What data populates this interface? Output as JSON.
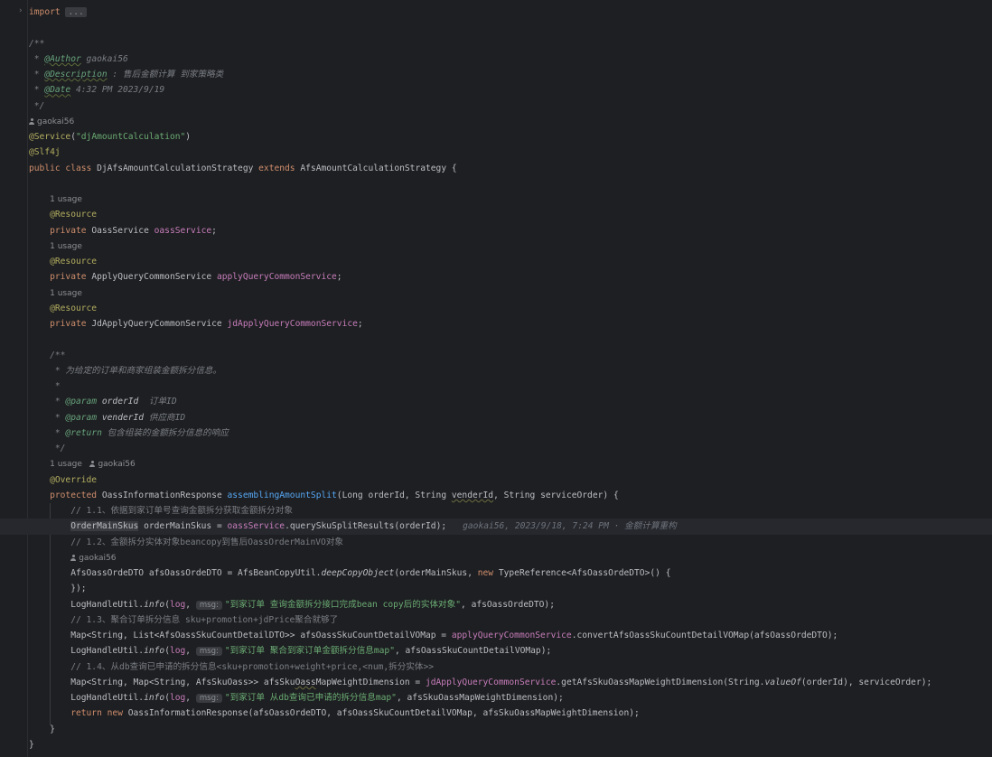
{
  "editor": {
    "colors": {
      "background": "#1e1f22",
      "keyword": "#cf8e6d",
      "annotation": "#b3ae60",
      "string": "#6aab73",
      "comment": "#7a7e85",
      "field": "#c77dbb",
      "method": "#56a8f5"
    },
    "highlighted_line": 33,
    "lines": [
      [
        [
          "kw",
          "import "
        ],
        [
          "fold-ph",
          "..."
        ]
      ],
      [],
      [
        [
          "doc",
          "/**"
        ]
      ],
      [
        [
          "doc",
          " * "
        ],
        [
          "tag",
          "@Author"
        ],
        [
          "doc",
          " "
        ],
        [
          "doc",
          "gaokai56"
        ]
      ],
      [
        [
          "doc",
          " * "
        ],
        [
          "tag",
          "@Description"
        ],
        [
          "doc",
          " : 售后金额计算 到家策略类"
        ]
      ],
      [
        [
          "doc",
          " * "
        ],
        [
          "tag",
          "@Date"
        ],
        [
          "doc",
          " 4:32 PM 2023/9/19"
        ]
      ],
      [
        [
          "doc",
          " */"
        ]
      ],
      [
        [
          "user",
          "gaokai56"
        ]
      ],
      [
        [
          "ann",
          "@Service"
        ],
        [
          "plain",
          "("
        ],
        [
          "str",
          "\"djAmountCalculation\""
        ],
        [
          "plain",
          ")"
        ]
      ],
      [
        [
          "ann",
          "@Slf4j"
        ]
      ],
      [
        [
          "kw",
          "public class "
        ],
        [
          "plain",
          "DjAfsAmountCalculationStrategy "
        ],
        [
          "kw",
          "extends "
        ],
        [
          "plain",
          "AfsAmountCalculationStrategy {"
        ]
      ],
      [],
      [
        [
          "indent",
          "    "
        ],
        [
          "hint",
          "1 usage"
        ]
      ],
      [
        [
          "ann",
          "    @Resource"
        ]
      ],
      [
        [
          "kw",
          "    private "
        ],
        [
          "plain",
          "OassService "
        ],
        [
          "fld",
          "oassService"
        ],
        [
          "plain",
          ";"
        ]
      ],
      [
        [
          "indent",
          "    "
        ],
        [
          "hint",
          "1 usage"
        ]
      ],
      [
        [
          "ann",
          "    @Resource"
        ]
      ],
      [
        [
          "kw",
          "    private "
        ],
        [
          "plain",
          "ApplyQueryCommonService "
        ],
        [
          "fld",
          "applyQueryCommonService"
        ],
        [
          "plain",
          ";"
        ]
      ],
      [
        [
          "indent",
          "    "
        ],
        [
          "hint",
          "1 usage"
        ]
      ],
      [
        [
          "ann",
          "    @Resource"
        ]
      ],
      [
        [
          "kw",
          "    private "
        ],
        [
          "plain",
          "JdApplyQueryCommonService "
        ],
        [
          "fld",
          "jdApplyQueryCommonService"
        ],
        [
          "plain",
          ";"
        ]
      ],
      [],
      [
        [
          "doc",
          "    /**"
        ]
      ],
      [
        [
          "doc",
          "     * 为给定的订单和商家组装金额拆分信息。"
        ]
      ],
      [
        [
          "doc",
          "     *"
        ]
      ],
      [
        [
          "doc",
          "     * "
        ],
        [
          "tagp",
          "@param "
        ],
        [
          "prm",
          "orderId"
        ],
        [
          "doc",
          "  订单ID"
        ]
      ],
      [
        [
          "doc",
          "     * "
        ],
        [
          "tagp",
          "@param "
        ],
        [
          "prm",
          "venderId"
        ],
        [
          "doc",
          " 供应商ID"
        ]
      ],
      [
        [
          "doc",
          "     * "
        ],
        [
          "tagp",
          "@return"
        ],
        [
          "doc",
          " 包含组装的金额拆分信息的响应"
        ]
      ],
      [
        [
          "doc",
          "     */"
        ]
      ],
      [
        [
          "indent",
          "    "
        ],
        [
          "hint",
          "1 usage   "
        ],
        [
          "user",
          "gaokai56"
        ]
      ],
      [
        [
          "ann",
          "    @Override"
        ]
      ],
      [
        [
          "kw",
          "    protected "
        ],
        [
          "plain",
          "OassInformationResponse "
        ],
        [
          "fn",
          "assemblingAmountSplit"
        ],
        [
          "plain",
          "(Long orderId, String "
        ],
        [
          "ul",
          "venderId"
        ],
        [
          "plain",
          ", String serviceOrder) {"
        ]
      ],
      [
        [
          "cm",
          "        // 1.1、依据到家订单号查询金额拆分获取金额拆分对象"
        ]
      ],
      [
        [
          "indent",
          "        "
        ],
        [
          "sel",
          "OrderMainSkus"
        ],
        [
          "plain",
          " orderMainSkus = "
        ],
        [
          "fld",
          "oassService"
        ],
        [
          "plain",
          ".querySkuSplitResults(orderId);"
        ],
        [
          "blame",
          "gaokai56, 2023/9/18, 7:24 PM · 金额计算重构"
        ]
      ],
      [
        [
          "cm",
          "        // 1.2、金额拆分实体对象beancopy到售后OassOrderMainVO对象"
        ]
      ],
      [
        [
          "indent",
          "        "
        ],
        [
          "user",
          "gaokai56"
        ]
      ],
      [
        [
          "plain",
          "        AfsOassOrdeDTO afsOassOrdeDTO = AfsBeanCopyUtil."
        ],
        [
          "it",
          "deepCopyObject"
        ],
        [
          "plain",
          "(orderMainSkus, "
        ],
        [
          "kw",
          "new "
        ],
        [
          "plain",
          "TypeReference<AfsOassOrdeDTO>() {"
        ]
      ],
      [
        [
          "plain",
          "        });"
        ]
      ],
      [
        [
          "plain",
          "        LogHandleUtil."
        ],
        [
          "it",
          "info"
        ],
        [
          "plain",
          "("
        ],
        [
          "fld",
          "log"
        ],
        [
          "plain",
          ", "
        ],
        [
          "pill",
          "msg:"
        ],
        [
          "str",
          "\"到家订单 查询金额拆分接口完成bean copy后的实体对象\""
        ],
        [
          "plain",
          ", afsOassOrdeDTO);"
        ]
      ],
      [
        [
          "cm",
          "        // 1.3、聚合订单拆分信息 sku+promotion+jdPrice聚合就够了"
        ]
      ],
      [
        [
          "plain",
          "        Map<String, List<AfsOassSkuCountDetailDTO>> afsOassSkuCountDetailVOMap = "
        ],
        [
          "fld",
          "applyQueryCommonService"
        ],
        [
          "plain",
          ".convertAfsOassSkuCountDetailVOMap(afsOassOrdeDTO);"
        ]
      ],
      [
        [
          "plain",
          "        LogHandleUtil."
        ],
        [
          "it",
          "info"
        ],
        [
          "plain",
          "("
        ],
        [
          "fld",
          "log"
        ],
        [
          "plain",
          ", "
        ],
        [
          "pill",
          "msg:"
        ],
        [
          "str",
          "\"到家订单 聚合到家订单金额拆分信息map\""
        ],
        [
          "plain",
          ", afsOassSkuCountDetailVOMap);"
        ]
      ],
      [
        [
          "cm",
          "        // 1.4、从db查询已申请的拆分信息<sku+promotion+weight+price,<num,拆分实体>>"
        ]
      ],
      [
        [
          "plain",
          "        Map<String, Map<String, AfsSkuOass>> afsSku"
        ],
        [
          "ul",
          "Oass"
        ],
        [
          "plain",
          "MapWeightDimension = "
        ],
        [
          "fld",
          "jdApplyQueryCommonService"
        ],
        [
          "plain",
          ".getAfsSkuOassMapWeightDimension(String."
        ],
        [
          "it",
          "valueOf"
        ],
        [
          "plain",
          "(orderId), serviceOrder);"
        ]
      ],
      [
        [
          "plain",
          "        LogHandleUtil."
        ],
        [
          "it",
          "info"
        ],
        [
          "plain",
          "("
        ],
        [
          "fld",
          "log"
        ],
        [
          "plain",
          ", "
        ],
        [
          "pill",
          "msg:"
        ],
        [
          "str",
          "\"到家订单 从db查询已申请的拆分信息map\""
        ],
        [
          "plain",
          ", afsSkuOassMapWeightDimension);"
        ]
      ],
      [
        [
          "kw",
          "        return new "
        ],
        [
          "plain",
          "OassInformationResponse(afsOassOrdeDTO, afsOassSkuCountDetailVOMap, afsSkuOassMapWeightDimension);"
        ]
      ],
      [
        [
          "plain",
          "    }"
        ]
      ],
      [
        [
          "plain",
          "}"
        ]
      ]
    ]
  }
}
